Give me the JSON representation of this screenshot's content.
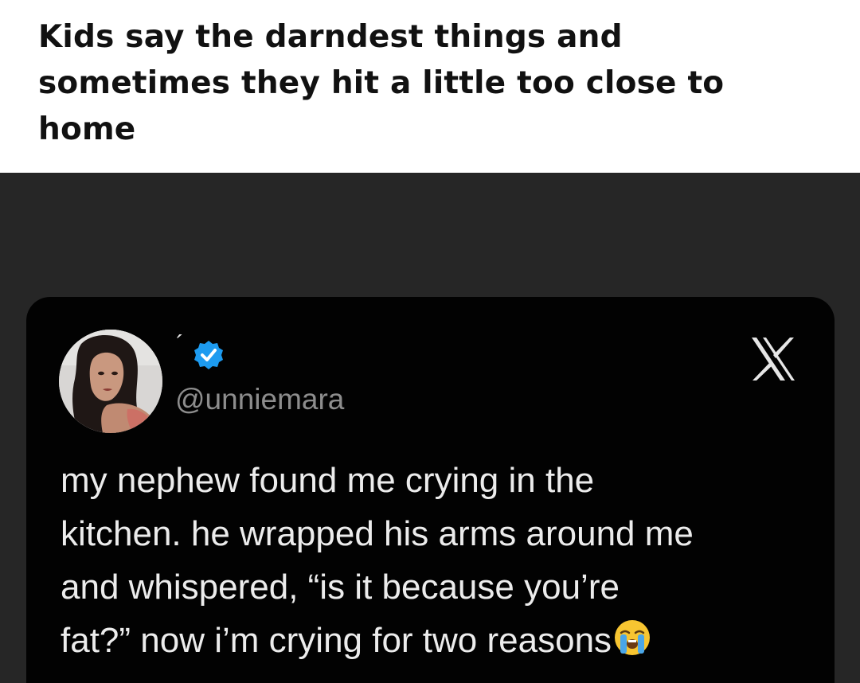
{
  "headline": {
    "text": "Kids say the darndest things and sometimes they hit a little too close to home"
  },
  "tweet": {
    "display_name": "´",
    "handle": "@unniemara",
    "verified": true,
    "platform_icon": "x-logo-icon",
    "text_lines": [
      "my nephew found me crying in the",
      "kitchen. he wrapped his arms around me",
      "and whispered, “is it because you’re",
      "fat?” now i’m crying for two reasons"
    ],
    "emoji": "loudly-crying-face-emoji"
  },
  "colors": {
    "background_outer": "#262626",
    "card": "#020202",
    "text_primary": "#ececec",
    "text_secondary": "#8d8d8d",
    "verified_blue": "#1d9bf0"
  }
}
